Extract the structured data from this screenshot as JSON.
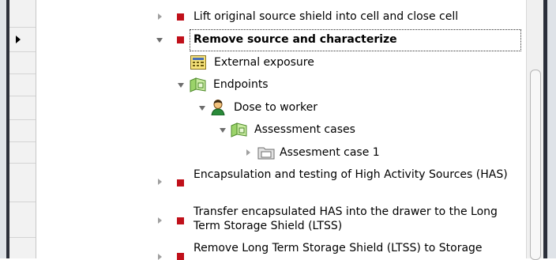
{
  "tree": {
    "row_lift": {
      "label": "Lift original source shield into cell and close cell"
    },
    "row_remove": {
      "label": "Remove source and characterize"
    },
    "row_external": {
      "label": "External exposure"
    },
    "row_endpoints": {
      "label": "Endpoints"
    },
    "row_dose": {
      "label": "Dose to worker"
    },
    "row_assessment_cases": {
      "label": "Assessment cases"
    },
    "row_assessment_case_1": {
      "label": "Assesment case 1"
    },
    "row_encapsulation": {
      "label": "Encapsulation and testing of High Activity Sources (HAS)"
    },
    "row_transfer": {
      "label": "Transfer encapsulated HAS into the drawer to the Long Term Storage Shield (LTSS)"
    },
    "row_remove_ltss": {
      "label": "Remove Long Term Storage Shield (LTSS) to Storage"
    }
  },
  "icons": {
    "task": "red-square-task-icon",
    "calculator": "calculator-icon",
    "endpoints_folder": "green-folder-icon",
    "worker": "person-icon",
    "case_folder": "gray-folder-icon"
  },
  "colors": {
    "task_red": "#c0101a",
    "selection_border": "#333333",
    "frame_dark": "#2b2f3a"
  }
}
